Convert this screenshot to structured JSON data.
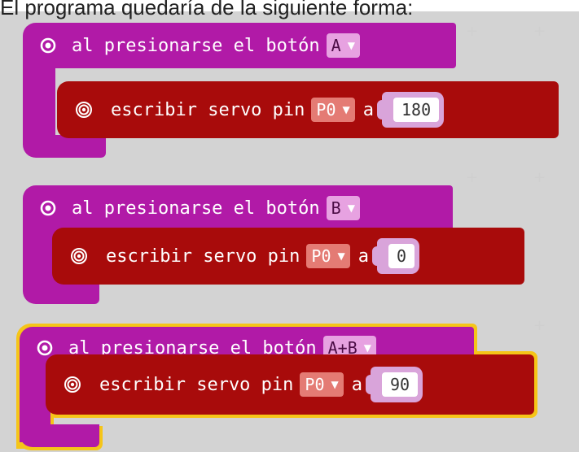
{
  "caption": "El programa quedaría de la siguiente forma:",
  "blocks": [
    {
      "event_label": "al presionarse el botón",
      "button": "A",
      "statement_label": "escribir servo pin",
      "pin": "P0",
      "to_label": "a",
      "value": "180",
      "selected": false
    },
    {
      "event_label": "al presionarse el botón",
      "button": "B",
      "statement_label": "escribir servo pin",
      "pin": "P0",
      "to_label": "a",
      "value": "0",
      "selected": false
    },
    {
      "event_label": "al presionarse el botón",
      "button": "A+B",
      "statement_label": "escribir servo pin",
      "pin": "P0",
      "to_label": "a",
      "value": "90",
      "selected": true
    }
  ],
  "icons": {
    "event": "radio-button-icon",
    "statement": "target-icon",
    "dropdown": "dropdown-arrow-icon"
  },
  "colors": {
    "event_block": "#b11aa7",
    "statement_block": "#a80b0b",
    "selection": "#f5c518",
    "workspace": "#ececec"
  }
}
